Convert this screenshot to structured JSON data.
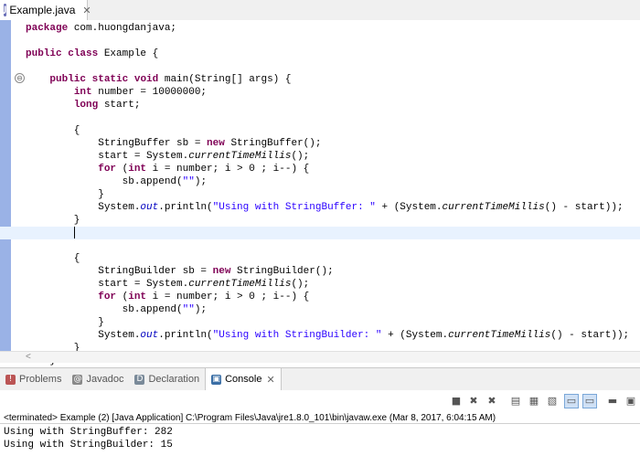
{
  "editor_tab": {
    "filename": "Example.java",
    "icon": "java-file-icon",
    "close": "✕"
  },
  "code_lines": [
    [
      {
        "t": "package ",
        "c": "kw"
      },
      {
        "t": "com.huongdanjava;"
      }
    ],
    [],
    [
      {
        "t": "public ",
        "c": "kw"
      },
      {
        "t": "class ",
        "c": "kw"
      },
      {
        "t": "Example {"
      }
    ],
    [],
    [
      {
        "t": "    "
      },
      {
        "t": "public ",
        "c": "kw"
      },
      {
        "t": "static ",
        "c": "kw"
      },
      {
        "t": "void ",
        "c": "kw"
      },
      {
        "t": "main(String[] args) {"
      }
    ],
    [
      {
        "t": "        "
      },
      {
        "t": "int ",
        "c": "kw"
      },
      {
        "t": "number = 10000000;"
      }
    ],
    [
      {
        "t": "        "
      },
      {
        "t": "long ",
        "c": "kw"
      },
      {
        "t": "start;"
      }
    ],
    [],
    [
      {
        "t": "        {"
      }
    ],
    [
      {
        "t": "            StringBuffer sb = "
      },
      {
        "t": "new ",
        "c": "kw"
      },
      {
        "t": "StringBuffer();"
      }
    ],
    [
      {
        "t": "            start = System."
      },
      {
        "t": "currentTimeMillis",
        "c": "mth"
      },
      {
        "t": "();"
      }
    ],
    [
      {
        "t": "            "
      },
      {
        "t": "for ",
        "c": "kw"
      },
      {
        "t": "("
      },
      {
        "t": "int ",
        "c": "kw"
      },
      {
        "t": "i = number; i > 0 ; i--) {"
      }
    ],
    [
      {
        "t": "                sb.append("
      },
      {
        "t": "\"\"",
        "c": "str"
      },
      {
        "t": ");"
      }
    ],
    [
      {
        "t": "            }"
      }
    ],
    [
      {
        "t": "            System."
      },
      {
        "t": "out",
        "c": "fld"
      },
      {
        "t": ".println("
      },
      {
        "t": "\"Using with StringBuffer: \"",
        "c": "str"
      },
      {
        "t": " + (System."
      },
      {
        "t": "currentTimeMillis",
        "c": "mth"
      },
      {
        "t": "() - start));"
      }
    ],
    [
      {
        "t": "        }"
      }
    ],
    [
      {
        "t": "        "
      },
      {
        "caret": true
      }
    ],
    [],
    [
      {
        "t": "        {"
      }
    ],
    [
      {
        "t": "            StringBuilder sb = "
      },
      {
        "t": "new ",
        "c": "kw"
      },
      {
        "t": "StringBuilder();"
      }
    ],
    [
      {
        "t": "            start = System."
      },
      {
        "t": "currentTimeMillis",
        "c": "mth"
      },
      {
        "t": "();"
      }
    ],
    [
      {
        "t": "            "
      },
      {
        "t": "for ",
        "c": "kw"
      },
      {
        "t": "("
      },
      {
        "t": "int ",
        "c": "kw"
      },
      {
        "t": "i = number; i > 0 ; i--) {"
      }
    ],
    [
      {
        "t": "                sb.append("
      },
      {
        "t": "\"\"",
        "c": "str"
      },
      {
        "t": ");"
      }
    ],
    [
      {
        "t": "            }"
      }
    ],
    [
      {
        "t": "            System."
      },
      {
        "t": "out",
        "c": "fld"
      },
      {
        "t": ".println("
      },
      {
        "t": "\"Using with StringBuilder: \"",
        "c": "str"
      },
      {
        "t": " + (System."
      },
      {
        "t": "currentTimeMillis",
        "c": "mth"
      },
      {
        "t": "() - start));"
      }
    ],
    [
      {
        "t": "        }"
      }
    ],
    [
      {
        "t": "    }"
      }
    ]
  ],
  "current_line_index": 16,
  "fold_marker": "⊖",
  "scroll_left_arrow": "<",
  "bottom_tabs": [
    {
      "label": "Problems",
      "icon": "problems-icon",
      "glyph": "!"
    },
    {
      "label": "Javadoc",
      "icon": "javadoc-icon",
      "glyph": "@"
    },
    {
      "label": "Declaration",
      "icon": "declaration-icon",
      "glyph": "D"
    },
    {
      "label": "Console",
      "icon": "console-icon",
      "glyph": "▣",
      "active": true,
      "close": "✕"
    }
  ],
  "console_toolbar": [
    {
      "name": "terminate-icon",
      "glyph": "■"
    },
    {
      "name": "remove-launch-icon",
      "glyph": "✖"
    },
    {
      "name": "remove-all-terminated-icon",
      "glyph": "✖"
    },
    {
      "name": "clear-console-icon",
      "glyph": "▤"
    },
    {
      "name": "scroll-lock-icon",
      "glyph": "▦"
    },
    {
      "name": "word-wrap-icon",
      "glyph": "▧"
    },
    {
      "name": "show-console-stdout-icon",
      "glyph": "▭",
      "pressed": true
    },
    {
      "name": "show-console-stderr-icon",
      "glyph": "▭",
      "pressed": true
    },
    {
      "name": "pin-console-icon",
      "glyph": "▬"
    },
    {
      "name": "display-selected-console-icon",
      "glyph": "▣"
    },
    {
      "name": "open-console-icon",
      "glyph": "▥"
    }
  ],
  "console": {
    "status": "<terminated> Example (2) [Java Application] C:\\Program Files\\Java\\jre1.8.0_101\\bin\\javaw.exe (Mar 8, 2017, 6:04:15 AM)",
    "output": [
      "Using with StringBuffer: 282",
      "Using with StringBuilder: 15"
    ]
  }
}
